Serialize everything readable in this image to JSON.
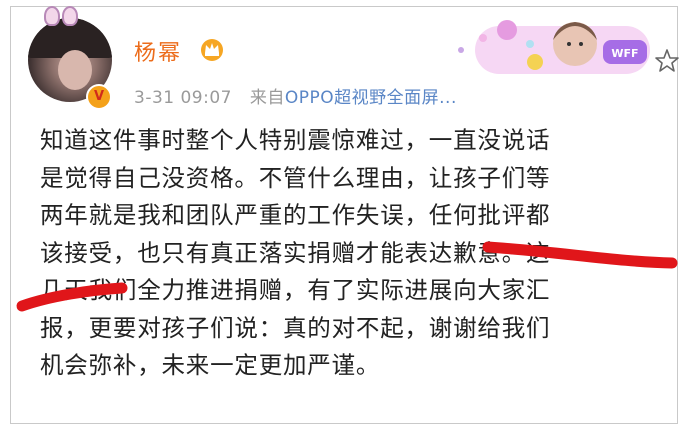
{
  "post": {
    "username": "杨幂",
    "verified_badge": "V",
    "time": "3-31 09:07",
    "source_prefix": "来自",
    "source_name": "OPPO超视野全面屏...",
    "lines": [
      "知道这件事时整个人特别震惊难过，一直没说话",
      "是觉得自己没资格。不管什么理由，让孩子们等",
      "两年就是我和团队严重的工作失误，任何批评都",
      "该接受，也只有真正落实捐赠才能表达歉意。这",
      "几天我们全力推进捐赠，有了实际进展向大家汇",
      "报，更要对孩子们说：真的对不起，谢谢给我们",
      "机会弥补，未来一定更加严谨。"
    ],
    "decoration_badge": "WFF"
  },
  "colors": {
    "username": "#ec6c1b",
    "source_link": "#5a86c6",
    "underline_marker": "#e0161a",
    "meta_gray": "#9a9a9a"
  },
  "icons": [
    "crown-icon",
    "verified-badge-icon",
    "favorite-star-icon",
    "decoration-card-icon"
  ]
}
